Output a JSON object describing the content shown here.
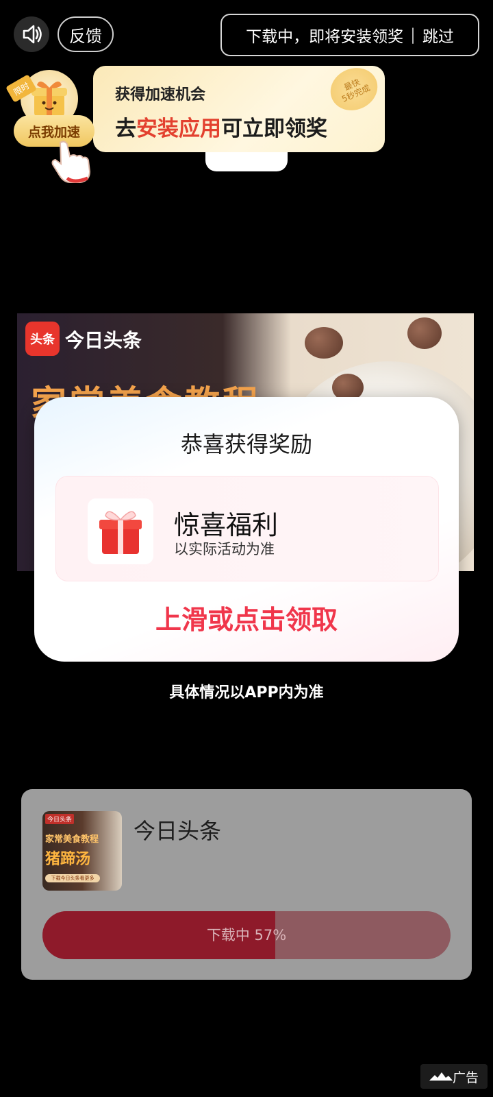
{
  "top_bar": {
    "sound_icon": "speaker-icon",
    "feedback_label": "反馈",
    "status_text": "下载中，即将安装领奖",
    "separator": "|",
    "skip_label": "跳过"
  },
  "speed_promo": {
    "limited_tag": "限时",
    "speed_button": "点我加速",
    "line1": "获得加速机会",
    "line2_prefix": "去",
    "line2_highlight": "安装应用",
    "line2_suffix": "可立即领奖",
    "badge_line1": "最快",
    "badge_line2": "5秒完成"
  },
  "ad_banner": {
    "logo_text": "头条",
    "app_name": "今日头条",
    "headline": "家常美食教程"
  },
  "reward_modal": {
    "title": "恭喜获得奖励",
    "reward_name": "惊喜福利",
    "reward_note": "以实际活动为准",
    "cta": "上滑或点击领取"
  },
  "disclaimer": "具体情况以APP内为准",
  "download_card": {
    "thumb_tag": "今日头条",
    "thumb_line1": "家常美食教程",
    "thumb_line2": "猪蹄汤",
    "thumb_button": "下载今日头条看更多",
    "app_name": "今日头条",
    "progress_text": "下载中 57%",
    "progress": 0.57
  },
  "ad_mark": "广告",
  "colors": {
    "accent_red": "#f0364b",
    "progress_fill": "#8e1a2a"
  }
}
